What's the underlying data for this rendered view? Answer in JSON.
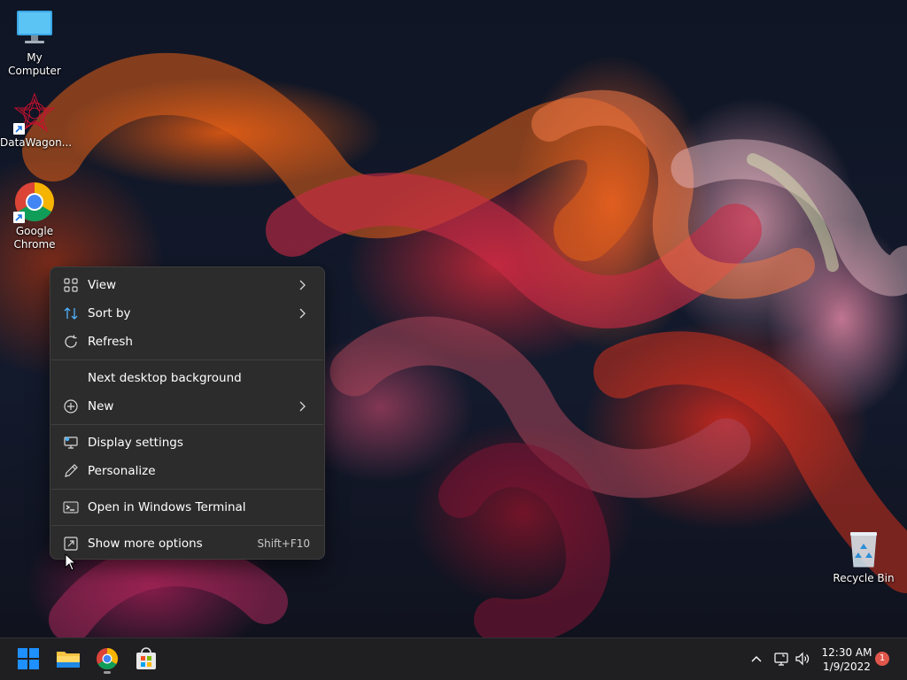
{
  "desktop": {
    "icons": [
      {
        "label": "My Computer",
        "icon": "monitor-icon"
      },
      {
        "label": "DataWagon...",
        "icon": "datawagon-icon"
      },
      {
        "label": "Google Chrome",
        "icon": "chrome-icon"
      },
      {
        "label": "Recycle Bin",
        "icon": "recycle-bin-icon"
      }
    ]
  },
  "context_menu": {
    "items": [
      {
        "label": "View",
        "icon": "grid-icon",
        "submenu": true
      },
      {
        "label": "Sort by",
        "icon": "sort-icon",
        "submenu": true
      },
      {
        "label": "Refresh",
        "icon": "refresh-icon"
      },
      {
        "label": "Next desktop background",
        "icon": ""
      },
      {
        "label": "New",
        "icon": "plus-circle-icon",
        "submenu": true
      },
      {
        "label": "Display settings",
        "icon": "display-settings-icon"
      },
      {
        "label": "Personalize",
        "icon": "pen-icon"
      },
      {
        "label": "Open in Windows Terminal",
        "icon": "terminal-icon"
      },
      {
        "label": "Show more options",
        "icon": "more-options-icon",
        "shortcut": "Shift+F10"
      }
    ]
  },
  "taskbar": {
    "apps": [
      "start-icon",
      "file-explorer-icon",
      "chrome-icon",
      "store-icon"
    ],
    "tray": {
      "time": "12:30 AM",
      "date": "1/9/2022",
      "notification_count": "1"
    }
  },
  "colors": {
    "menu_bg": "#2c2c2c",
    "taskbar_bg": "#1f1f22",
    "start_blue": "#1e90ff",
    "badge": "#e0564b"
  }
}
